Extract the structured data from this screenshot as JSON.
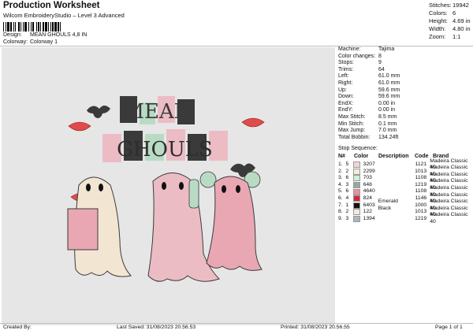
{
  "header": {
    "title": "Production Worksheet",
    "software": "Wilcom EmbroideryStudio – Level 3 Advanced",
    "design_label": "Design:",
    "design_value": "MEAN GHOULS 4,8 IN",
    "colorway_label": "Colorway:",
    "colorway_value": "Colorway 1"
  },
  "stats": [
    {
      "label": "Stitches:",
      "value": "19942"
    },
    {
      "label": "Colors:",
      "value": "6"
    },
    {
      "label": "Height:",
      "value": "4.69 in"
    },
    {
      "label": "Width:",
      "value": "4.80 in"
    },
    {
      "label": "Zoom:",
      "value": "1:1"
    }
  ],
  "design_art": {
    "title_top": "MEAN",
    "title_bottom": "GHOULS",
    "colors": {
      "cream": "#f2e6d2",
      "pink": "#ecbcc4",
      "rose": "#e9a7b3",
      "green": "#b9dbc4",
      "dark": "#3a3a3a",
      "red": "#e04b4b"
    }
  },
  "machine_info": [
    {
      "label": "Machine:",
      "value": "Tajima"
    },
    {
      "label": "Color changes:",
      "value": "8"
    },
    {
      "label": "Stops:",
      "value": "9"
    },
    {
      "label": "Trims:",
      "value": "64"
    },
    {
      "label": "Left:",
      "value": "61.0 mm"
    },
    {
      "label": "Right:",
      "value": "61.0 mm"
    },
    {
      "label": "Up:",
      "value": "59.6 mm"
    },
    {
      "label": "Down:",
      "value": "59.6 mm"
    },
    {
      "label": "EndX:",
      "value": "0.00 in"
    },
    {
      "label": "EndY:",
      "value": "0.00 in"
    },
    {
      "label": "Max Stitch:",
      "value": "8.5 mm"
    },
    {
      "label": "Min Stitch:",
      "value": "0.1 mm"
    },
    {
      "label": "Max Jump:",
      "value": "7.0 mm"
    },
    {
      "label": "Total Bobbin:",
      "value": "134.24ft"
    }
  ],
  "sequence": {
    "title": "Stop Sequence:",
    "headers": {
      "n": "N#",
      "color": "Color",
      "description": "Description",
      "code": "Code",
      "brand": "Brand"
    },
    "rows": [
      {
        "stop": "1.",
        "n": "5",
        "color": "3207",
        "swatch": "#f2d3d6",
        "description": "",
        "code": "1121",
        "brand": "Madeira Classic 40"
      },
      {
        "stop": "2.",
        "n": "2",
        "color": "2299",
        "swatch": "#f5ecd9",
        "description": "",
        "code": "1013",
        "brand": "Madeira Classic 40"
      },
      {
        "stop": "3.",
        "n": "6",
        "color": "703",
        "swatch": "#cfeed6",
        "description": "",
        "code": "1108",
        "brand": "Madeira Classic 40"
      },
      {
        "stop": "4.",
        "n": "3",
        "color": "648",
        "swatch": "#9aa7a0",
        "description": "",
        "code": "1219",
        "brand": "Madeira Classic 40"
      },
      {
        "stop": "5.",
        "n": "6",
        "color": "4640",
        "swatch": "#ee8e9e",
        "description": "",
        "code": "1108",
        "brand": "Madeira Classic 40"
      },
      {
        "stop": "6.",
        "n": "4",
        "color": "824",
        "swatch": "#d7263d",
        "description": "",
        "code": "1146",
        "brand": "Madeira Classic 40"
      },
      {
        "stop": "7.",
        "n": "1",
        "color": "6403",
        "swatch": "#111111",
        "description": "Emerald Black",
        "code": "1000",
        "brand": "Madeira Classic 40"
      },
      {
        "stop": "8.",
        "n": "2",
        "color": "122",
        "swatch": "#f7e6e6",
        "description": "",
        "code": "1013",
        "brand": "Madeira Classic 40"
      },
      {
        "stop": "9.",
        "n": "3",
        "color": "1394",
        "swatch": "#a9b7c0",
        "description": "",
        "code": "1219",
        "brand": "Madeira Classic 40"
      }
    ]
  },
  "footer": {
    "created": "Created By:",
    "saved": "Last Saved: 31/08/2023 20.56.53",
    "printed": "Printed: 31/08/2023 20.56.55",
    "page": "Page 1 of 1"
  }
}
